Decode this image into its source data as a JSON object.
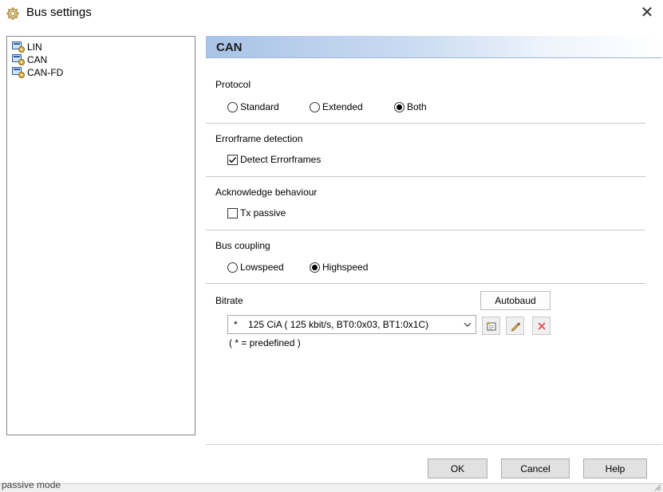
{
  "window": {
    "title": "Bus settings",
    "close_glyph": "✕"
  },
  "tree": {
    "items": [
      "LIN",
      "CAN",
      "CAN-FD"
    ],
    "icon": "bus-node-icon"
  },
  "panel": {
    "title": "CAN"
  },
  "protocol": {
    "label": "Protocol",
    "options": [
      "Standard",
      "Extended",
      "Both"
    ],
    "selected": "Both"
  },
  "errorframe": {
    "label": "Errorframe detection",
    "checkbox_label": "Detect Errorframes",
    "checked": true
  },
  "acknowledge": {
    "label": "Acknowledge behaviour",
    "checkbox_label": "Tx passive",
    "checked": false
  },
  "bus_coupling": {
    "label": "Bus coupling",
    "options": [
      "Lowspeed",
      "Highspeed"
    ],
    "selected": "Highspeed"
  },
  "bitrate": {
    "label": "Bitrate",
    "autobaud_label": "Autobaud",
    "selected_value": "*    125 CiA ( 125 kbit/s, BT0:0x03, BT1:0x1C)",
    "note": "( * = predefined )"
  },
  "buttons": {
    "ok": "OK",
    "cancel": "Cancel",
    "help": "Help"
  },
  "background_text": "passive mode",
  "colors": {
    "header_accent": "#a9c3e6",
    "delete_icon": "#d9534f"
  }
}
